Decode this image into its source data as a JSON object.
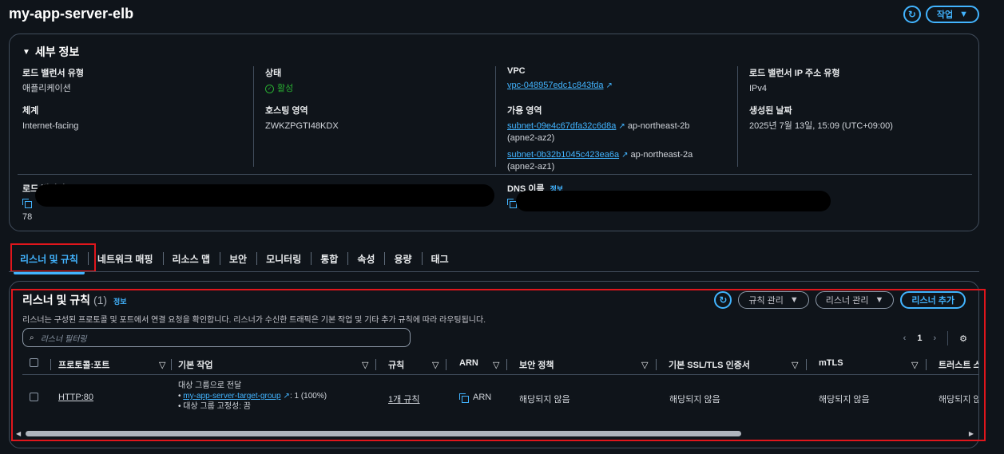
{
  "page": {
    "title": "my-app-server-elb",
    "action_label": "작업"
  },
  "details": {
    "header": "세부 정보",
    "lb_type_label": "로드 밸런서 유형",
    "lb_type_value": "애플리케이션",
    "scheme_label": "체계",
    "scheme_value": "Internet-facing",
    "status_label": "상태",
    "status_value": "활성",
    "hosted_zone_label": "호스팅 영역",
    "hosted_zone_value": "ZWKZPGTI48KDX",
    "vpc_label": "VPC",
    "vpc_value": "vpc-048957edc1c843fda",
    "az_label": "가용 영역",
    "az": [
      {
        "subnet": "subnet-09e4c67dfa32c6d8a",
        "region": "ap-northeast-2b",
        "zone": "(apne2-az2)"
      },
      {
        "subnet": "subnet-0b32b1045c423ea6a",
        "region": "ap-northeast-2a",
        "zone": "(apne2-az1)"
      }
    ],
    "ip_type_label": "로드 밸런서 IP 주소 유형",
    "ip_type_value": "IPv4",
    "created_label": "생성된 날짜",
    "created_value": "2025년 7월 13일, 15:09 (UTC+09:00)",
    "arn_label": "로드 밸런서 ARN",
    "arn_suffix": "78",
    "dns_label": "DNS 이름",
    "dns_info": "정보"
  },
  "tabs": [
    "리스너 및 규칙",
    "네트워크 매핑",
    "리소스 맵",
    "보안",
    "모니터링",
    "통합",
    "속성",
    "용량",
    "태그"
  ],
  "listeners": {
    "title": "리스너 및 규칙",
    "count": "(1)",
    "info": "정보",
    "description": "리스너는 구성된 프로토콜 및 포트에서 연결 요청을 확인합니다. 리스너가 수신한 트래픽은 기본 작업 및 기타 추가 규칙에 따라 라우팅됩니다.",
    "manage_rules": "규칙 관리",
    "manage_listeners": "리스너 관리",
    "add_listener": "리스너 추가",
    "search_placeholder": "리스너 필터링",
    "page_number": "1",
    "columns": [
      "프로토콜:포트",
      "기본 작업",
      "규칙",
      "ARN",
      "보안 정책",
      "기본 SSL/TLS 인증서",
      "mTLS",
      "트러스트 스"
    ],
    "row": {
      "protocol": "HTTP:80",
      "action_title": "대상 그룹으로 전달",
      "target_group": "my-app-server-target-group",
      "target_weight": ": 1 (100%)",
      "stickiness": "대상 그룹 고정성: 끔",
      "rules": "1개 규칙",
      "arn": "ARN",
      "security_policy": "해당되지 않음",
      "ssl_cert": "해당되지 않음",
      "mtls": "해당되지 않음",
      "trust": "해당되지 않음"
    }
  },
  "colors": {
    "accent": "#42b4ff",
    "highlight": "#e0161c",
    "ok": "#29ad32",
    "bg": "#0f141a"
  }
}
